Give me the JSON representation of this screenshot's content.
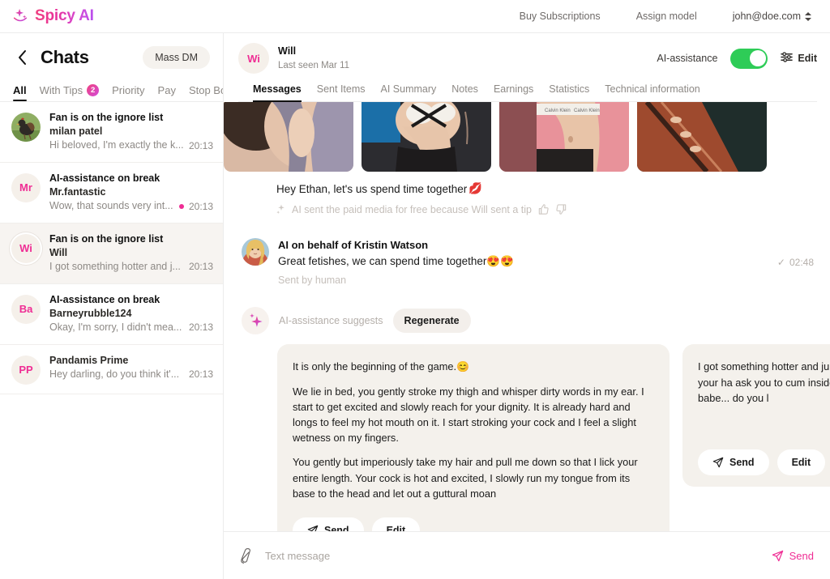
{
  "topbar": {
    "brand": "Spicy AI",
    "links": [
      "Buy Subscriptions",
      "Assign model"
    ],
    "user": "john@doe.com"
  },
  "sidebar": {
    "title": "Chats",
    "mass_dm": "Mass DM",
    "filters": [
      {
        "label": "All",
        "active": true,
        "badge": null
      },
      {
        "label": "With Tips",
        "active": false,
        "badge": "2"
      },
      {
        "label": "Priority",
        "active": false,
        "badge": null
      },
      {
        "label": "Pay",
        "active": false,
        "badge": null
      },
      {
        "label": "Stop Bo",
        "active": false,
        "badge": null
      }
    ],
    "chats": [
      {
        "status": "Fan is on the ignore list",
        "name": "milan patel",
        "preview": "Hi beloved, I'm exactly the k...",
        "time": "20:13",
        "initials": "",
        "photo": true,
        "unread": false,
        "selected": false
      },
      {
        "status": "AI-assistance on break",
        "name": "Mr.fantastic",
        "preview": "Wow, that sounds very int...",
        "time": "20:13",
        "initials": "Mr",
        "photo": false,
        "unread": true,
        "selected": false
      },
      {
        "status": "Fan is on the ignore list",
        "name": "Will",
        "preview": "I got something hotter and j...",
        "time": "20:13",
        "initials": "Wi",
        "photo": false,
        "unread": false,
        "selected": true
      },
      {
        "status": "AI-assistance on break",
        "name": "Barneyrubble124",
        "preview": "Okay, I'm sorry, I didn't mea...",
        "time": "20:13",
        "initials": "Ba",
        "photo": false,
        "unread": false,
        "selected": false
      },
      {
        "status": "",
        "name": "Pandamis Prime",
        "preview": "Hey darling, do you think it'...",
        "time": "20:13",
        "initials": "PP",
        "photo": false,
        "unread": false,
        "selected": false
      }
    ]
  },
  "chat": {
    "peer_initials": "Wi",
    "peer_name": "Will",
    "peer_seen": "Last seen Mar 11",
    "ai_assistance_label": "AI-assistance",
    "ai_assistance_on": true,
    "edit_label": "Edit",
    "tabs": [
      {
        "label": "Messages",
        "active": true
      },
      {
        "label": "Sent Items",
        "active": false
      },
      {
        "label": "AI Summary",
        "active": false
      },
      {
        "label": "Notes",
        "active": false
      },
      {
        "label": "Earnings",
        "active": false
      },
      {
        "label": "Statistics",
        "active": false
      },
      {
        "label": "Technical information",
        "active": false
      }
    ],
    "media_message": {
      "caption": "Hey Ethan, let's us spend time together",
      "caption_emoji": "💋",
      "note": "AI sent the paid media for free because Will sent a tip"
    },
    "sent_message": {
      "from": "AI on behalf of Kristin Watson",
      "text": "Great fetishes, we can spend time together",
      "emoji": "😍😍",
      "sub": "Sent by human",
      "time": "02:48",
      "check": "✓"
    },
    "suggestion": {
      "label": "AI-assistance suggests",
      "regenerate": "Regenerate",
      "cards": [
        {
          "paragraphs": [
            "It is only the beginning of the game.😊",
            "We lie in bed, you gently stroke my thigh and whisper dirty words in my ear. I start to get excited and slowly reach for your dignity. It is already hard and longs to feel my hot mouth on it. I start stroking your cock and I feel a slight wetness on my fingers.",
            "You gently but imperiously take my hair and pull me down so that I lick your entire length. Your cock is hot and excited, I slowly run my tongue from its base to the head and let out a guttural moan"
          ],
          "send": "Send",
          "edit": "Edit"
        },
        {
          "paragraphs": [
            "I got something hotter and ju swallow it deep while your ha ask you to cum inside and th tight asshole babe... do you l"
          ],
          "send": "Send",
          "edit": "Edit"
        }
      ]
    },
    "composer": {
      "placeholder": "Text message",
      "send_label": "Send"
    }
  }
}
